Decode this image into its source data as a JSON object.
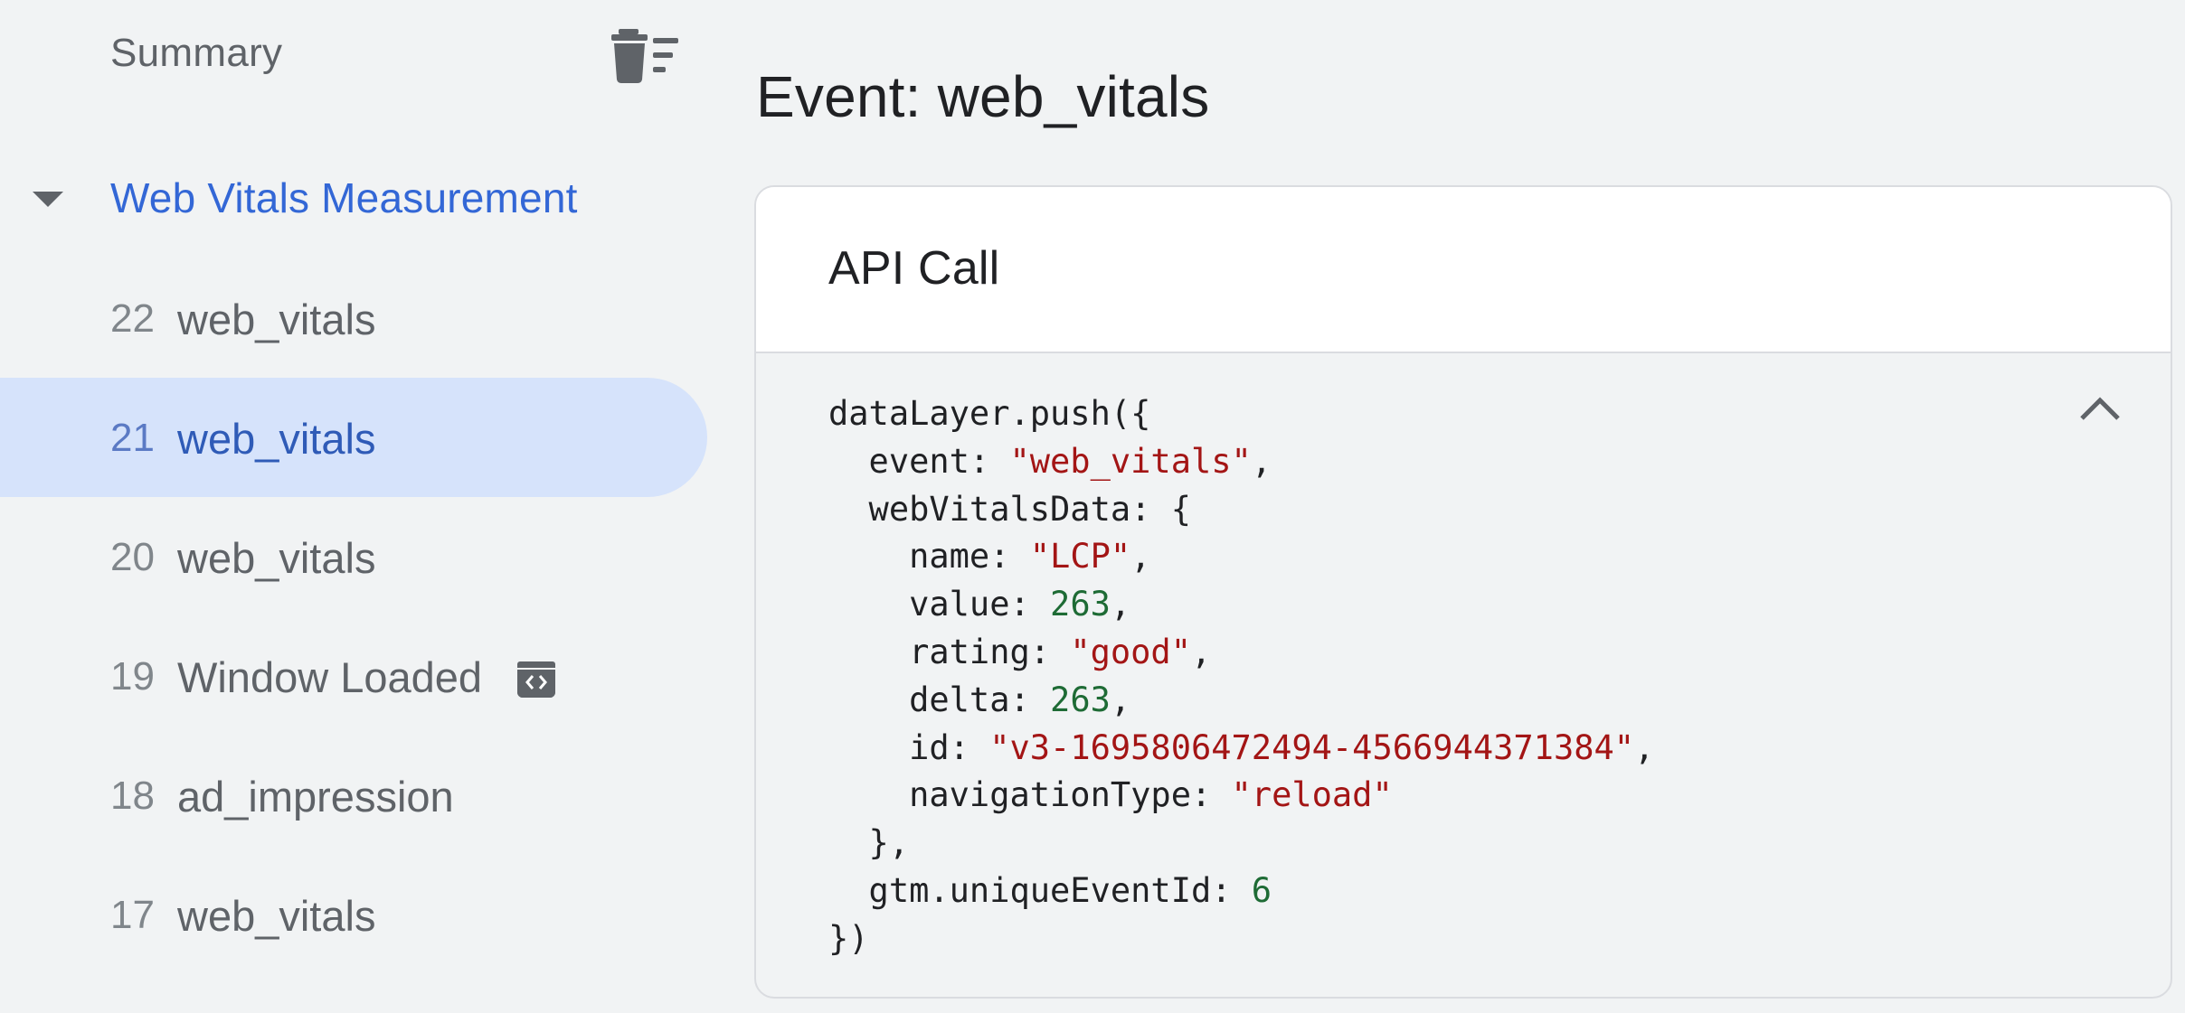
{
  "sidebar": {
    "summary_label": "Summary",
    "container_label": "Web Vitals Measurement",
    "events": [
      {
        "num": "22",
        "name": "web_vitals"
      },
      {
        "num": "21",
        "name": "web_vitals"
      },
      {
        "num": "20",
        "name": "web_vitals"
      },
      {
        "num": "19",
        "name": "Window Loaded"
      },
      {
        "num": "18",
        "name": "ad_impression"
      },
      {
        "num": "17",
        "name": "web_vitals"
      }
    ]
  },
  "main": {
    "title": "Event: web_vitals",
    "card_title": "API Call",
    "code": {
      "l1": "dataLayer.push({",
      "event_key": "  event: ",
      "event_val": "\"web_vitals\"",
      "comma": ",",
      "wvd": "  webVitalsData: {",
      "name_key": "    name: ",
      "name_val": "\"LCP\"",
      "value_key": "    value: ",
      "value_val": "263",
      "rating_key": "    rating: ",
      "rating_val": "\"good\"",
      "delta_key": "    delta: ",
      "delta_val": "263",
      "id_key": "    id: ",
      "id_val": "\"v3-1695806472494-4566944371384\"",
      "nav_key": "    navigationType: ",
      "nav_val": "\"reload\"",
      "close_inner": "  },",
      "gtm_key": "  gtm.uniqueEventId: ",
      "gtm_val": "6",
      "close": "})"
    }
  },
  "colors": {
    "accent": "#3367d6",
    "selected_bg": "#d6e3fb",
    "string": "#a31515",
    "number": "#1e6b35"
  },
  "icons": [
    "delete-summary-icon",
    "caret-down-icon",
    "code-badge-icon",
    "chevron-up-icon"
  ]
}
